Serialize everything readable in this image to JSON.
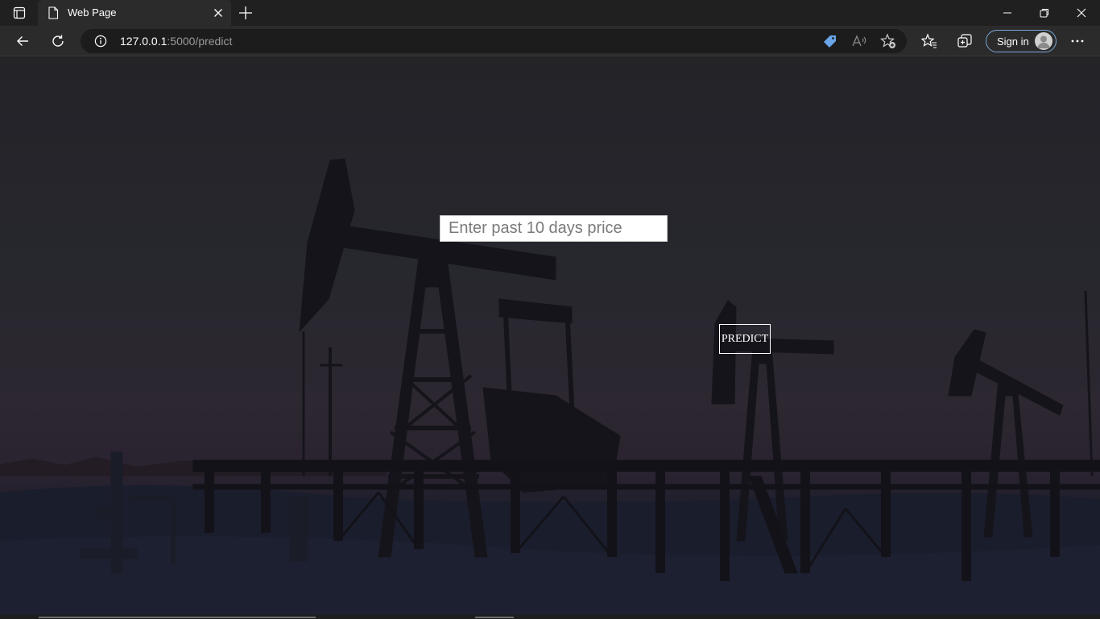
{
  "browser": {
    "tab_title": "Web Page",
    "url_host": "127.0.0.1",
    "url_rest": ":5000/predict",
    "signin_label": "Sign in"
  },
  "icons": {
    "tab_actions": "tab-actions-icon",
    "page": "page-icon",
    "close_tab": "close-icon",
    "new_tab": "plus-icon",
    "minimize": "minimize-icon",
    "restore": "restore-icon",
    "close_window": "close-icon",
    "back": "back-arrow-icon",
    "refresh": "refresh-icon",
    "site_info": "info-icon",
    "shopping": "tag-icon",
    "read_aloud": "read-aloud-icon",
    "add_favorite": "add-favorite-icon",
    "favorites": "favorites-icon",
    "collections": "collections-icon",
    "more": "more-icon"
  },
  "form": {
    "price_placeholder": "Enter past 10 days price",
    "price_value": "",
    "predict_label": "PREDICT"
  },
  "colors": {
    "chrome_bg": "#202020",
    "toolbar_bg": "#2b2b2b",
    "tag_icon": "#6aa5e8",
    "signin_border": "#7aa7d6"
  }
}
